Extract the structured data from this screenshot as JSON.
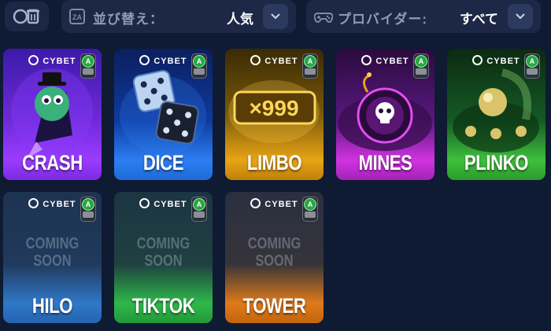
{
  "toolbar": {
    "sort": {
      "label": "並び替え：",
      "value": "人気"
    },
    "provider": {
      "label": "プロバイダー:",
      "value": "すべて"
    }
  },
  "games": [
    {
      "title": "CRASH",
      "brand": "CYBET",
      "badge": "A",
      "coming_soon": ""
    },
    {
      "title": "DICE",
      "brand": "CYBET",
      "badge": "A",
      "coming_soon": ""
    },
    {
      "title": "LIMBO",
      "brand": "CYBET",
      "badge": "A",
      "coming_soon": "",
      "art_text": "×999"
    },
    {
      "title": "MINES",
      "brand": "CYBET",
      "badge": "A",
      "coming_soon": ""
    },
    {
      "title": "PLINKO",
      "brand": "CYBET",
      "badge": "A",
      "coming_soon": ""
    },
    {
      "title": "HILO",
      "brand": "CYBET",
      "badge": "A",
      "coming_soon": "COMING\nSOON"
    },
    {
      "title": "TIKTOK",
      "brand": "CYBET",
      "badge": "A",
      "coming_soon": "COMING\nSOON"
    },
    {
      "title": "TOWER",
      "brand": "CYBET",
      "badge": "A",
      "coming_soon": "COMING\nSOON"
    }
  ],
  "colors": {
    "background": "#0f1a33",
    "panel": "#1c2846",
    "crash": "#9b3cff",
    "dice": "#2c7ef2",
    "limbo": "#e8a415",
    "mines": "#d033e0",
    "plinko": "#3fc03c",
    "hilo": "#2f78c8",
    "tiktok": "#2eb84a",
    "tower": "#e07a1a"
  },
  "icons": {
    "clear": "clear-filters-icon",
    "sort": "sort-icon",
    "provider": "gamepad-icon",
    "dropdown": "chevron-down-icon"
  }
}
